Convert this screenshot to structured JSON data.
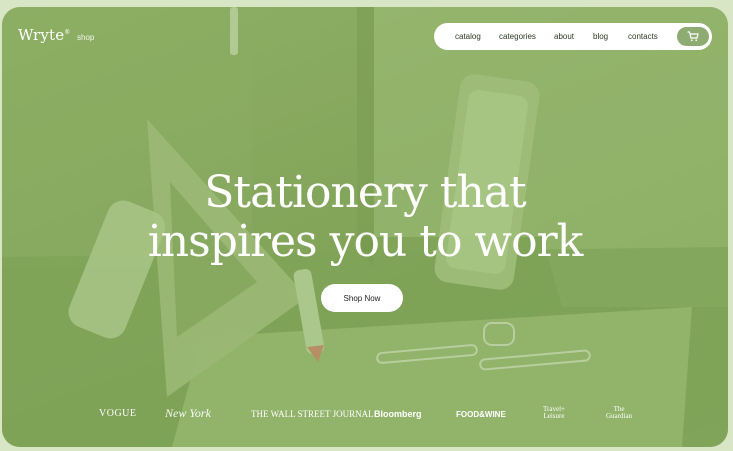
{
  "brand": {
    "name": "Wryte",
    "mark": "®"
  },
  "header": {
    "shop_label": "shop"
  },
  "nav": {
    "items": [
      {
        "label": "catalog"
      },
      {
        "label": "categories"
      },
      {
        "label": "about"
      },
      {
        "label": "blog"
      },
      {
        "label": "contacts"
      }
    ],
    "cart_icon": "cart-icon"
  },
  "hero": {
    "line1": "Stationery that",
    "line2": "inspires you to work",
    "cta_label": "Shop Now"
  },
  "press": {
    "logos": [
      {
        "name": "VOGUE"
      },
      {
        "name": "New York"
      },
      {
        "name": "THE WALL STREET JOURNAL"
      },
      {
        "name": "Bloomberg"
      },
      {
        "name": "FOOD&WINE"
      },
      {
        "name_line1": "Travel+",
        "name_line2": "Leisure"
      },
      {
        "name_line1": "The",
        "name_line2": "Guardian"
      }
    ]
  },
  "colors": {
    "background": "#d9e6c6",
    "hero_green": "#8aad63",
    "cart_button": "#8eab72",
    "nav_bg": "#ffffff"
  }
}
